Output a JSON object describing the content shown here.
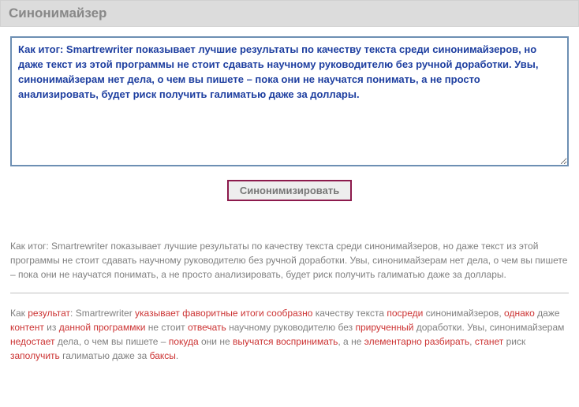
{
  "header": {
    "title": "Синонимайзер"
  },
  "form": {
    "textarea_value": "Как итог: Smartrewriter показывает лучшие результаты по качеству текста среди синонимайзеров, но даже текст из этой программы не стоит сдавать научному руководителю без ручной доработки. Увы, синонимайзерам нет дела, о чем вы пишете – пока они не научатся понимать, а не просто анализировать, будет риск получить галиматью даже за доллары.",
    "submit_label": "Синонимизировать"
  },
  "result": {
    "original": "Как итог: Smartrewriter показывает лучшие результаты по качеству текста среди синонимайзеров, но даже текст из этой программы не стоит сдавать научному руководителю без ручной доработки. Увы, синонимайзерам нет дела, о чем вы пишете – пока они не научатся понимать, а не просто анализировать, будет риск получить галиматью даже за доллары.",
    "rewritten_tokens": [
      {
        "t": "Как ",
        "h": false
      },
      {
        "t": "результат",
        "h": true
      },
      {
        "t": ": Smartrewriter ",
        "h": false
      },
      {
        "t": "указывает",
        "h": true
      },
      {
        "t": " ",
        "h": false
      },
      {
        "t": "фаворитные",
        "h": true
      },
      {
        "t": " ",
        "h": false
      },
      {
        "t": "итоги",
        "h": true
      },
      {
        "t": " ",
        "h": false
      },
      {
        "t": "сообразно",
        "h": true
      },
      {
        "t": " качеству текста ",
        "h": false
      },
      {
        "t": "посреди",
        "h": true
      },
      {
        "t": " синонимайзеров, ",
        "h": false
      },
      {
        "t": "однако",
        "h": true
      },
      {
        "t": " даже ",
        "h": false
      },
      {
        "t": "контент",
        "h": true
      },
      {
        "t": " из ",
        "h": false
      },
      {
        "t": "данной",
        "h": true
      },
      {
        "t": " ",
        "h": false
      },
      {
        "t": "программки",
        "h": true
      },
      {
        "t": " не стоит ",
        "h": false
      },
      {
        "t": "отвечать",
        "h": true
      },
      {
        "t": " научному руководителю без ",
        "h": false
      },
      {
        "t": "прирученный",
        "h": true
      },
      {
        "t": " доработки. Увы, синонимайзерам ",
        "h": false
      },
      {
        "t": "недостает",
        "h": true
      },
      {
        "t": " дела, о чем вы пишете – ",
        "h": false
      },
      {
        "t": "покуда",
        "h": true
      },
      {
        "t": " они не ",
        "h": false
      },
      {
        "t": "выучатся",
        "h": true
      },
      {
        "t": " ",
        "h": false
      },
      {
        "t": "воспринимать",
        "h": true
      },
      {
        "t": ", а не ",
        "h": false
      },
      {
        "t": "элементарно",
        "h": true
      },
      {
        "t": " ",
        "h": false
      },
      {
        "t": "разбирать",
        "h": true
      },
      {
        "t": ", ",
        "h": false
      },
      {
        "t": "станет",
        "h": true
      },
      {
        "t": " риск ",
        "h": false
      },
      {
        "t": "заполучить",
        "h": true
      },
      {
        "t": " галиматью даже за ",
        "h": false
      },
      {
        "t": "баксы",
        "h": true
      },
      {
        "t": ".",
        "h": false
      }
    ]
  }
}
